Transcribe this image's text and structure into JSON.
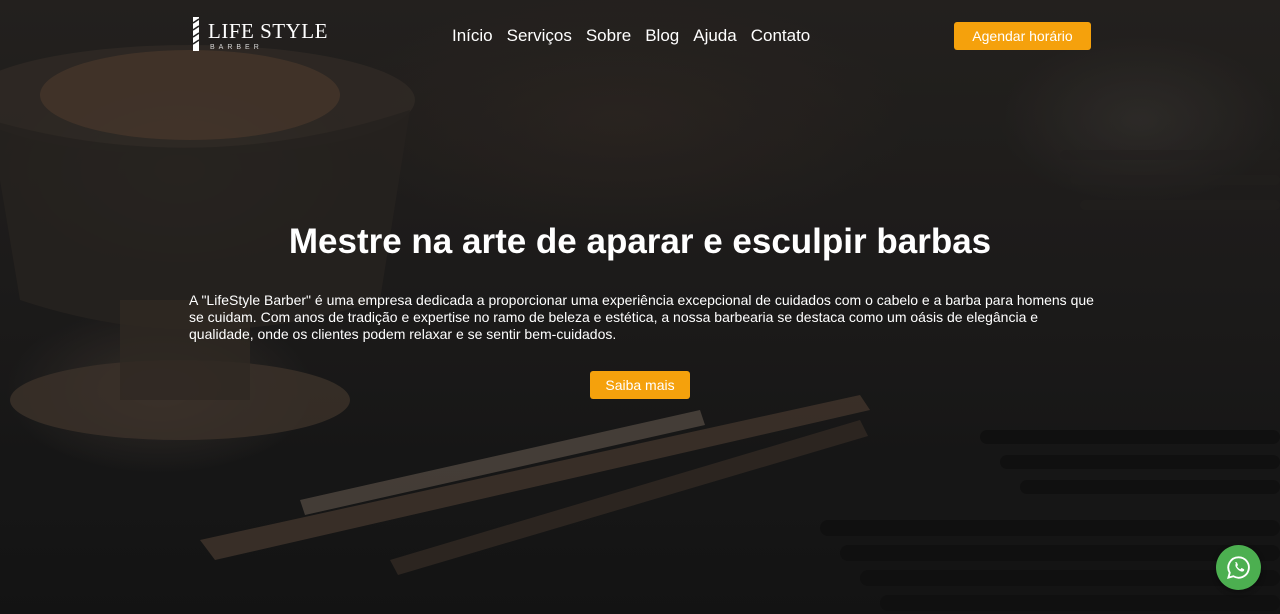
{
  "header": {
    "logo_title": "LIFE STYLE",
    "logo_subtitle": "BARBER",
    "nav": [
      "Início",
      "Serviços",
      "Sobre",
      "Blog",
      "Ajuda",
      "Contato"
    ],
    "cta_label": "Agendar horário"
  },
  "main": {
    "title": "Mestre na arte de aparar e esculpir barbas",
    "description": "A \"LifeStyle Barber\" é uma empresa dedicada a proporcionar uma experiência excepcional de cuidados com o cabelo e a barba para homens que se cuidam. Com anos de tradição e expertise no ramo de beleza e estética, a nossa barbearia se destaca como um oásis de elegância e qualidade, onde os clientes podem relaxar e se sentir bem-cuidados.",
    "cta_label": "Saiba mais"
  },
  "floating": {
    "whatsapp_icon": "whatsapp-icon"
  },
  "colors": {
    "accent": "#f5a10c",
    "whatsapp": "#4caf50",
    "text": "#ffffff"
  }
}
